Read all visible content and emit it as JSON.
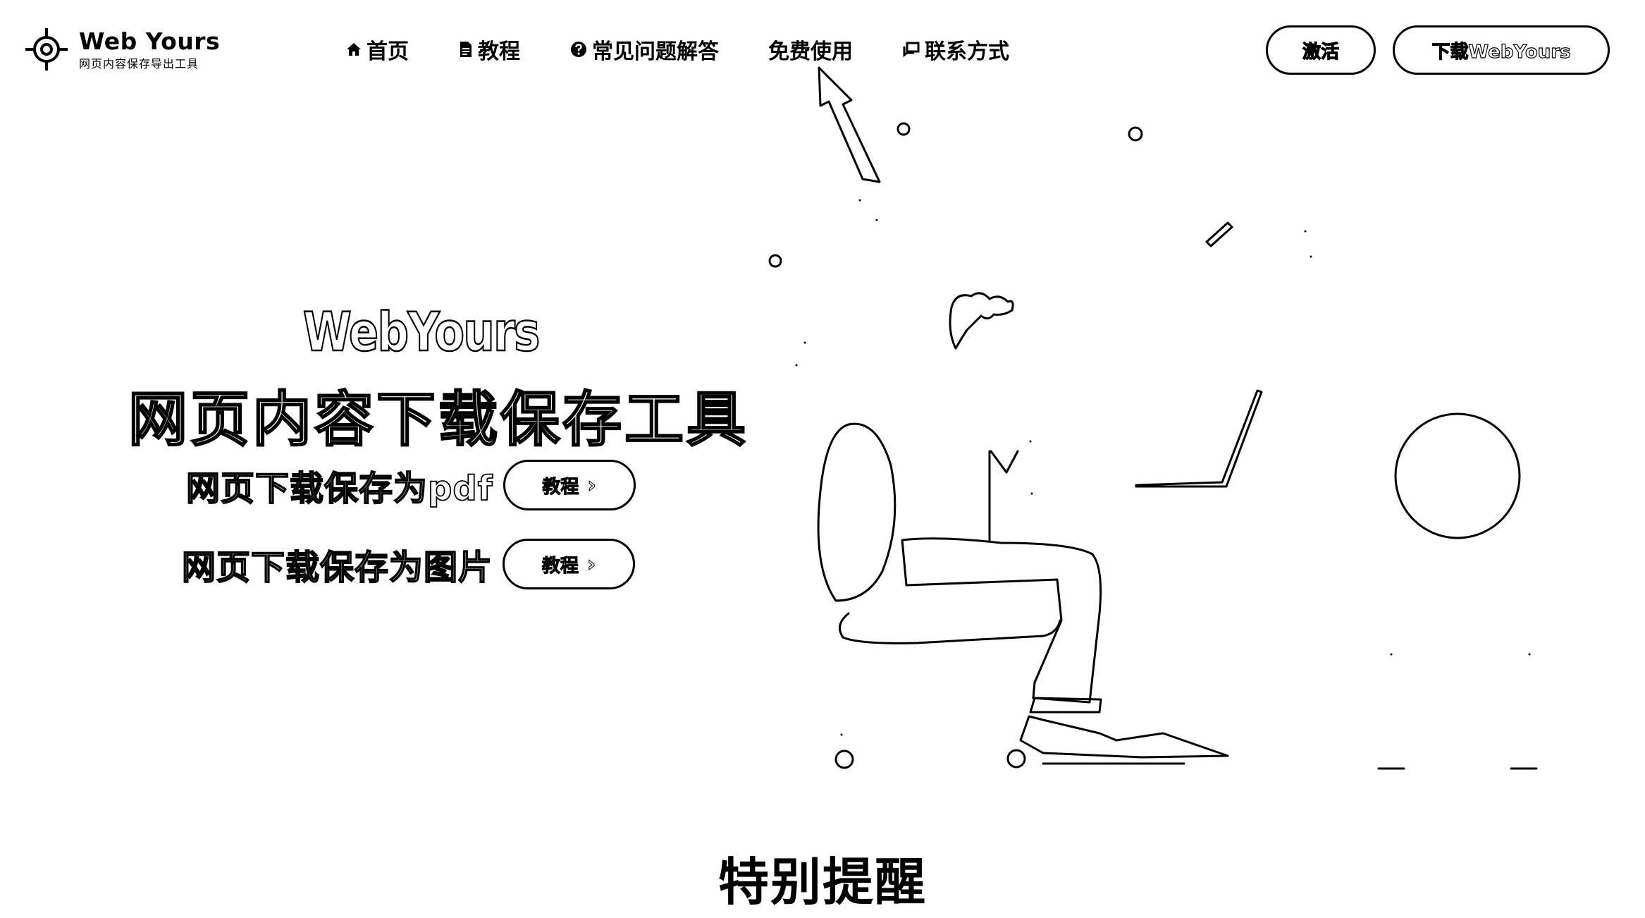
{
  "brand": {
    "name": "Web Yours",
    "tagline": "网页内容保存导出工具",
    "logo_icon": "crosshair-target-icon"
  },
  "nav": {
    "items": [
      {
        "label": "首页",
        "icon": "home-icon"
      },
      {
        "label": "教程",
        "icon": "document-icon"
      },
      {
        "label": "常见问题解答",
        "icon": "help-circle-icon"
      },
      {
        "label": "免费使用",
        "icon": ""
      },
      {
        "label": "联系方式",
        "icon": "chat-icon"
      }
    ]
  },
  "header_buttons": {
    "activate": "激活",
    "download": "下载WebYours"
  },
  "hero": {
    "title": "WebYours",
    "subtitle": "网页内容下载保存工具",
    "rows": [
      {
        "label": "网页下载保存为pdf",
        "button": "教程"
      },
      {
        "label": "网页下载保存为图片",
        "button": "教程"
      }
    ]
  },
  "section": {
    "heading": "特别提醒"
  },
  "colors": {
    "foreground": "#000000",
    "background": "#ffffff"
  }
}
